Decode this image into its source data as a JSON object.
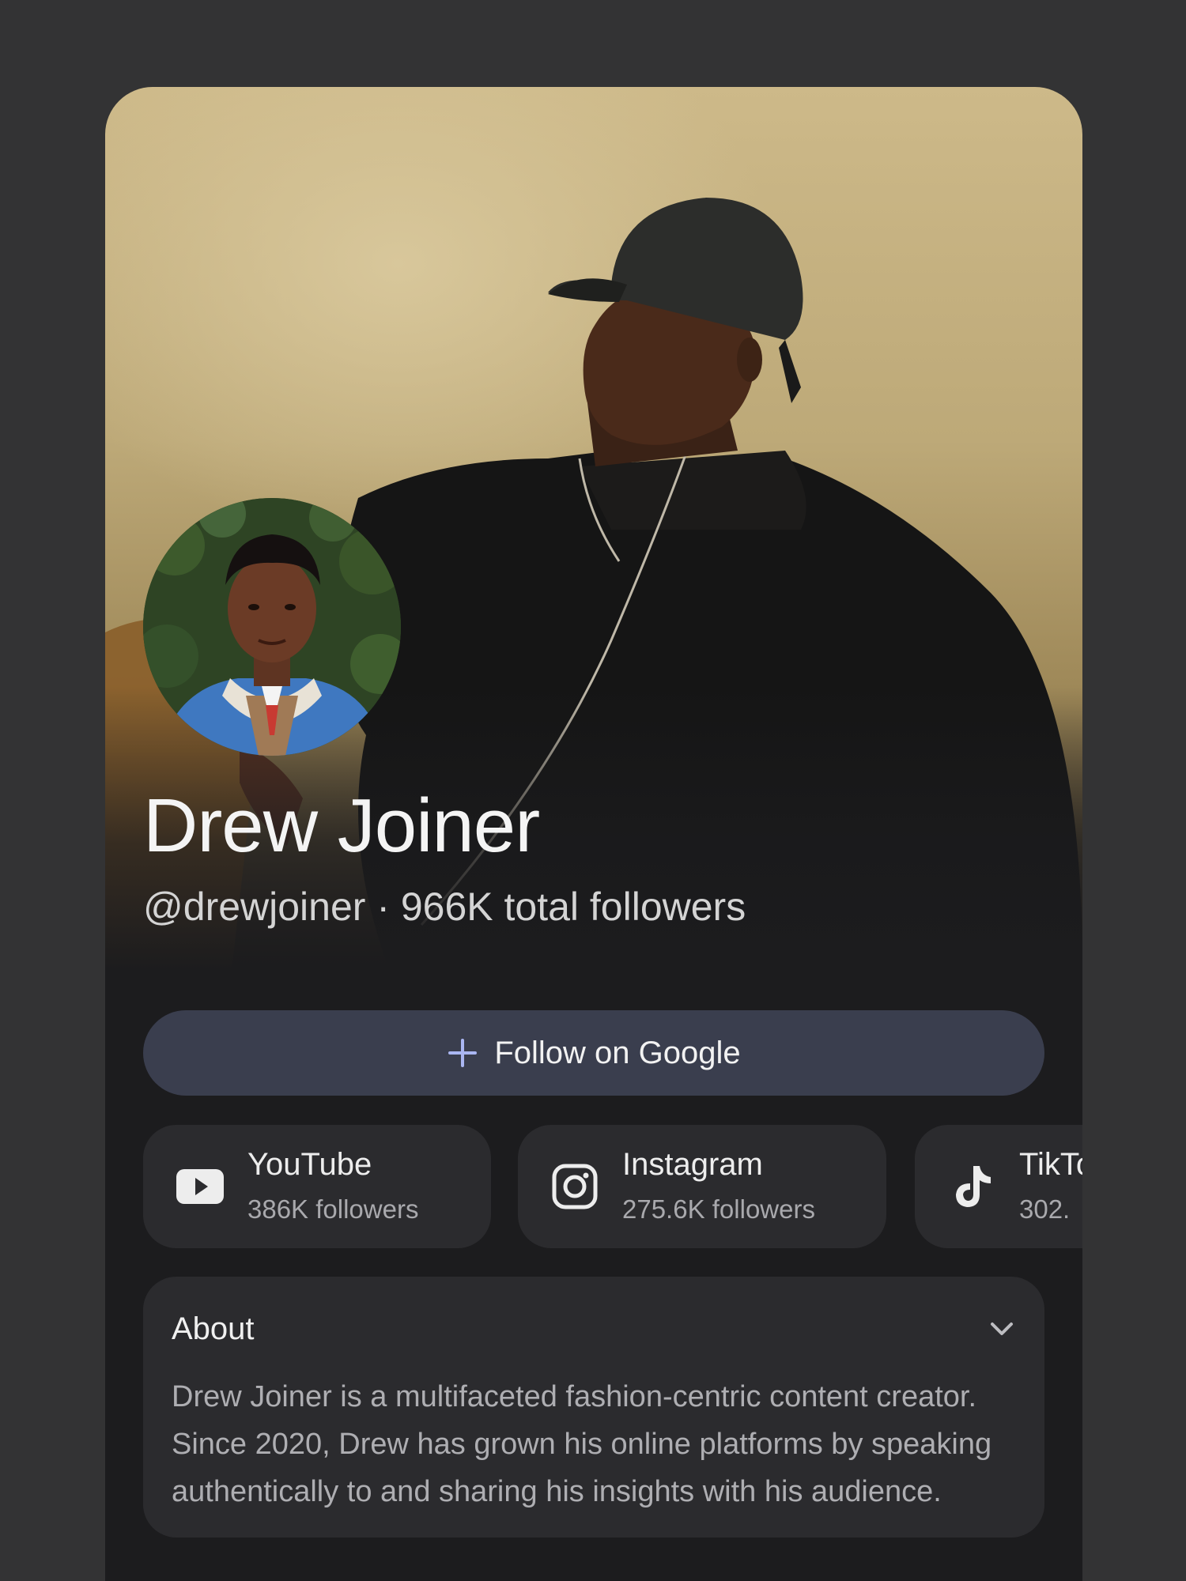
{
  "profile": {
    "name": "Drew Joiner",
    "handle_line": "@drewjoiner · 966K total followers"
  },
  "follow": {
    "label": "Follow on Google",
    "icon": "plus-icon"
  },
  "socials": [
    {
      "platform": "YouTube",
      "followers": "386K followers",
      "icon": "youtube-icon"
    },
    {
      "platform": "Instagram",
      "followers": "275.6K followers",
      "icon": "instagram-icon"
    },
    {
      "platform": "TikTok",
      "followers": "302.",
      "icon": "tiktok-icon"
    }
  ],
  "about": {
    "title": "About",
    "text": "Drew Joiner is a multifaceted fashion-centric content creator. Since 2020, Drew has grown his online platforms by speaking authentically to and sharing his insights with his audience.",
    "toggle_icon": "chevron-down-icon"
  },
  "colors": {
    "background": "#333334",
    "card": "#1c1c1e",
    "follow_button": "#3a3e4e",
    "accent_plus": "#aab6f2",
    "chip": "#2b2b2e"
  }
}
